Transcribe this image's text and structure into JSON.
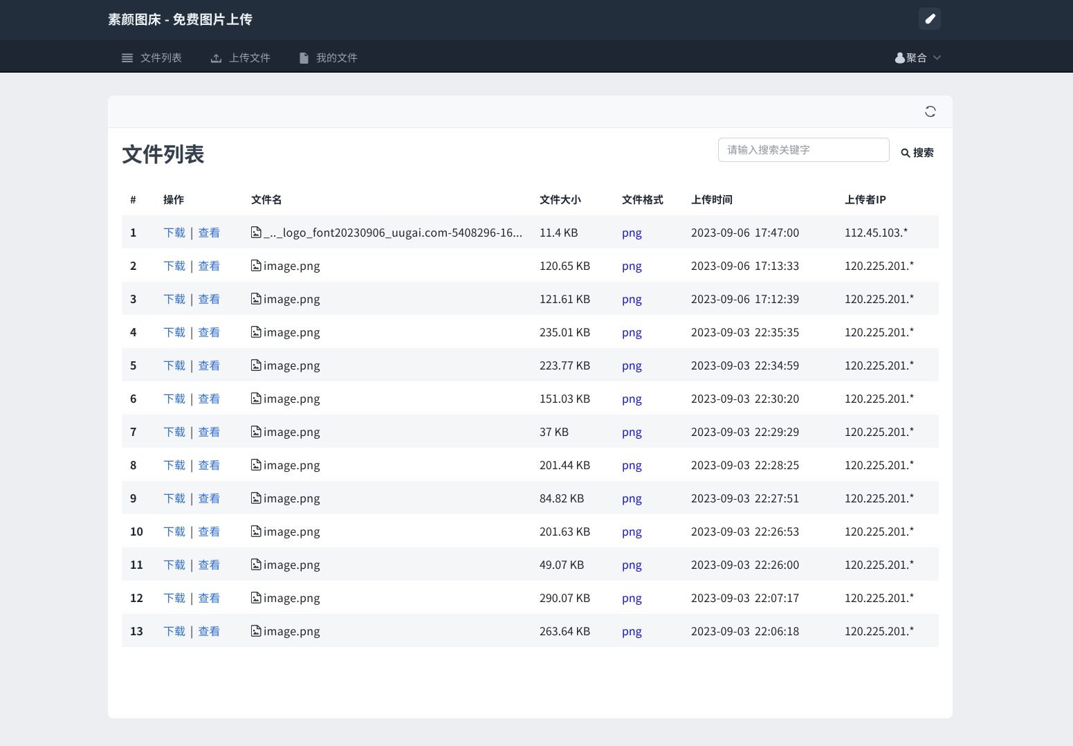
{
  "theme": {
    "topbar_bg": "#232e3d",
    "navbar_bg": "#1d2632",
    "page_bg": "#eceef2",
    "panel_bg": "#ffffff",
    "stripe_bg": "#f5f6f8",
    "action_link_color": "#2e6ed8",
    "format_link_color": "#0f0fe4"
  },
  "header": {
    "title": "素颜图床 - 免费图片上传",
    "theme_button_icon": "brush-icon"
  },
  "nav": {
    "items": [
      {
        "icon": "list-icon",
        "label": "文件列表"
      },
      {
        "icon": "upload-icon",
        "label": "上传文件"
      },
      {
        "icon": "file-icon",
        "label": "我的文件"
      }
    ],
    "user_menu": {
      "icon": "qq-penguin-icon",
      "label": "聚合",
      "chevron": "chevron-down-icon"
    }
  },
  "panel": {
    "title": "文件列表",
    "toolbar": {
      "refresh_icon": "refresh-icon"
    },
    "search": {
      "placeholder": "请输入搜索关键字",
      "button_label": "搜索",
      "icon": "search-icon"
    },
    "table": {
      "columns": [
        "#",
        "操作",
        "文件名",
        "文件大小",
        "文件格式",
        "上传时间",
        "上传者IP"
      ],
      "row_actions": [
        "下载",
        "查看"
      ],
      "action_separator": "|",
      "rows": [
        {
          "index": 1,
          "filename": "_.._logo_font20230906_uugai.com-5408296-16...",
          "size": "11.4 KB",
          "format": "png",
          "uploaded_at": "2023-09-06 17:47:00",
          "uploader_ip": "112.45.103.*"
        },
        {
          "index": 2,
          "filename": "image.png",
          "size": "120.65 KB",
          "format": "png",
          "uploaded_at": "2023-09-06 17:13:33",
          "uploader_ip": "120.225.201.*"
        },
        {
          "index": 3,
          "filename": "image.png",
          "size": "121.61 KB",
          "format": "png",
          "uploaded_at": "2023-09-06 17:12:39",
          "uploader_ip": "120.225.201.*"
        },
        {
          "index": 4,
          "filename": "image.png",
          "size": "235.01 KB",
          "format": "png",
          "uploaded_at": "2023-09-03 22:35:35",
          "uploader_ip": "120.225.201.*"
        },
        {
          "index": 5,
          "filename": "image.png",
          "size": "223.77 KB",
          "format": "png",
          "uploaded_at": "2023-09-03 22:34:59",
          "uploader_ip": "120.225.201.*"
        },
        {
          "index": 6,
          "filename": "image.png",
          "size": "151.03 KB",
          "format": "png",
          "uploaded_at": "2023-09-03 22:30:20",
          "uploader_ip": "120.225.201.*"
        },
        {
          "index": 7,
          "filename": "image.png",
          "size": "37 KB",
          "format": "png",
          "uploaded_at": "2023-09-03 22:29:29",
          "uploader_ip": "120.225.201.*"
        },
        {
          "index": 8,
          "filename": "image.png",
          "size": "201.44 KB",
          "format": "png",
          "uploaded_at": "2023-09-03 22:28:25",
          "uploader_ip": "120.225.201.*"
        },
        {
          "index": 9,
          "filename": "image.png",
          "size": "84.82 KB",
          "format": "png",
          "uploaded_at": "2023-09-03 22:27:51",
          "uploader_ip": "120.225.201.*"
        },
        {
          "index": 10,
          "filename": "image.png",
          "size": "201.63 KB",
          "format": "png",
          "uploaded_at": "2023-09-03 22:26:53",
          "uploader_ip": "120.225.201.*"
        },
        {
          "index": 11,
          "filename": "image.png",
          "size": "49.07 KB",
          "format": "png",
          "uploaded_at": "2023-09-03 22:26:00",
          "uploader_ip": "120.225.201.*"
        },
        {
          "index": 12,
          "filename": "image.png",
          "size": "290.07 KB",
          "format": "png",
          "uploaded_at": "2023-09-03 22:07:17",
          "uploader_ip": "120.225.201.*"
        },
        {
          "index": 13,
          "filename": "image.png",
          "size": "263.64 KB",
          "format": "png",
          "uploaded_at": "2023-09-03 22:06:18",
          "uploader_ip": "120.225.201.*"
        }
      ]
    }
  }
}
